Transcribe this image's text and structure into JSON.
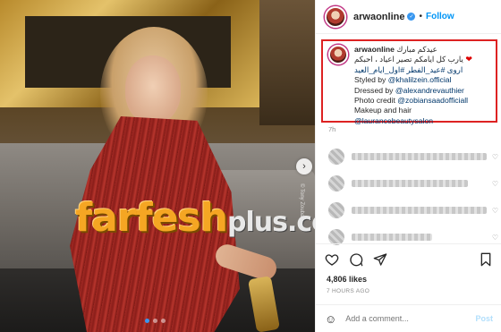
{
  "photo": {
    "next_icon": "chevron-right-icon",
    "side_credit": "© Tony Zoubaa",
    "carousel_dots": 3,
    "active_dot": 1
  },
  "watermark": {
    "main": "farfesh",
    "plus": "plus.com"
  },
  "header": {
    "username": "arwaonline",
    "verified_icon": "check",
    "separator": "•",
    "follow_label": "Follow"
  },
  "caption": {
    "username": "arwaonline",
    "line1": "عيدكم مبارك",
    "heart": "❤",
    "line2": "يارب كل ايامكم تصير اعياد ، احبكم",
    "line3": "اروى #عيد_الفطر #اول_ايام_العيد",
    "styled_by": "Styled by",
    "styled_by_handle": "@khalilzein.official",
    "dressed_by": "Dressed by",
    "dressed_by_handle": "@alexandrevauthier",
    "photo_credit": "Photo credit",
    "photo_credit_handle": "@zobiansaadofficiall",
    "makeup": "Makeup and hair",
    "makeup_handle": "@laurancebeautysalon",
    "time": "7h"
  },
  "comments": {
    "heart_icon": "♡"
  },
  "actions": {
    "like_icon": "heart-icon",
    "comment_icon": "comment-icon",
    "share_icon": "share-icon",
    "save_icon": "bookmark-icon"
  },
  "likes": "4,806 likes",
  "timestamp": "7 HOURS AGO",
  "add_comment": {
    "emoji_icon": "☺",
    "placeholder": "Add a comment...",
    "post_label": "Post"
  },
  "colors": {
    "accent_blue": "#0095f6",
    "highlight_red": "#dd2222",
    "watermark_orange": "#f5a623"
  }
}
